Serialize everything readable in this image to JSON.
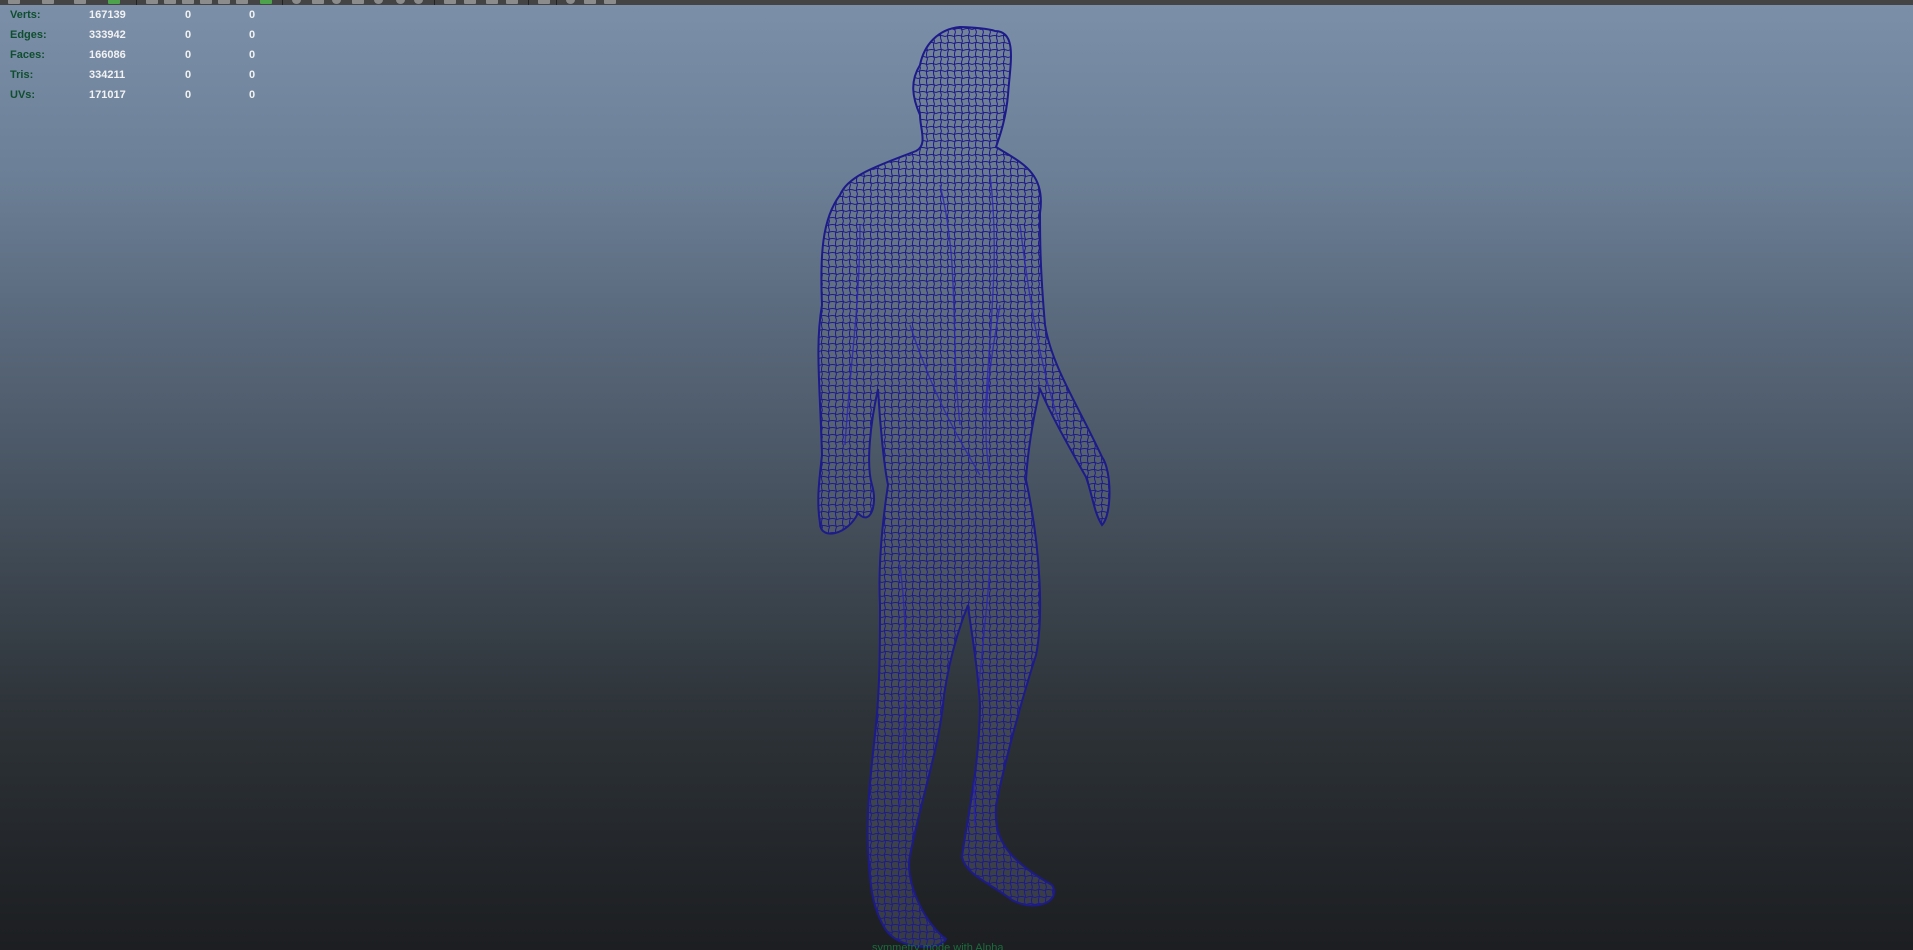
{
  "hud": {
    "rows": [
      {
        "label": "Verts:",
        "v1": "167139",
        "v2": "0",
        "v3": "0"
      },
      {
        "label": "Edges:",
        "v1": "333942",
        "v2": "0",
        "v3": "0"
      },
      {
        "label": "Faces:",
        "v1": "166086",
        "v2": "0",
        "v3": "0"
      },
      {
        "label": "Tris:",
        "v1": "334211",
        "v2": "0",
        "v3": "0"
      },
      {
        "label": "UVs:",
        "v1": "171017",
        "v2": "0",
        "v3": "0"
      }
    ]
  },
  "viewport": {
    "message": "symmetry mode with Alpha"
  },
  "colors": {
    "wireframe": "#1d1a8a",
    "hud_label": "#0f4e2e",
    "hud_value": "#f2f2f2"
  }
}
